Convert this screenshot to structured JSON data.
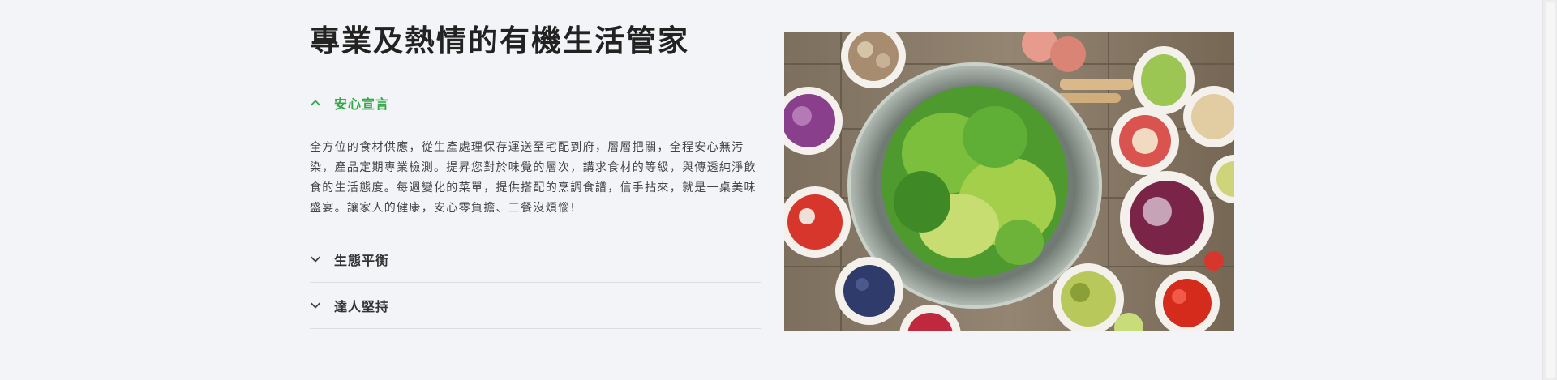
{
  "section": {
    "title": "專業及熱情的有機生活管家"
  },
  "accordion": [
    {
      "label": "安心宣言",
      "expanded": true,
      "icon": "chevron-up-icon",
      "body": "全方位的食材供應，從生產處理保存運送至宅配到府，層層把關，全程安心無污染，產品定期專業檢測。提昇您對於味覺的層次，講求食材的等級，與傳透純淨飲食的生活態度。每週變化的菜單，提供搭配的烹調食譜，信手拈來，就是一桌美味盛宴。讓家人的健康，安心零負擔、三餐沒煩惱!"
    },
    {
      "label": "生態平衡",
      "expanded": false,
      "icon": "chevron-down-icon"
    },
    {
      "label": "達人堅持",
      "expanded": false,
      "icon": "chevron-down-icon"
    }
  ],
  "colors": {
    "accent": "#35a849",
    "background": "#f3f4f8",
    "divider": "#dcdde2"
  }
}
